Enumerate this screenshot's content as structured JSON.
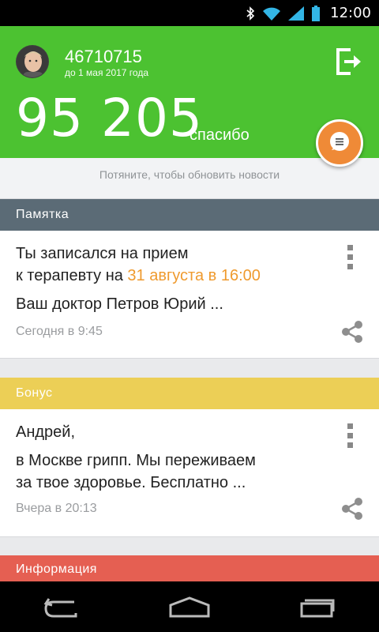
{
  "status_bar": {
    "time": "12:00",
    "icons": [
      "bluetooth-icon",
      "wifi-icon",
      "signal-icon",
      "battery-icon"
    ]
  },
  "header": {
    "account_number": "46710715",
    "valid_until": "до 1 мая 2017 года",
    "balance": "95 205",
    "balance_unit": "спасибо",
    "background_color": "#4cc231",
    "icons": [
      "avatar",
      "logout-icon",
      "chat-icon"
    ]
  },
  "pull_hint": "Потяните, чтобы обновить новости",
  "sections": [
    {
      "title": "Памятка",
      "color": "#5b6b76",
      "card": {
        "line1": "Ты записался на прием",
        "line2_prefix": "к терапевту на ",
        "line2_highlight": "31 августа в 16:00",
        "preview": "Ваш доктор Петров Юрий ...",
        "timestamp": "Сегодня в 9:45"
      }
    },
    {
      "title": "Бонус",
      "color": "#eccf56",
      "card": {
        "line1": "Андрей,",
        "line2": "в Москве грипп. Мы переживаем",
        "line3": "за твое здоровье. Бесплатно ...",
        "timestamp": "Вчера в 20:13"
      }
    },
    {
      "title": "Информация",
      "color": "#e55f52"
    }
  ],
  "nav_bar": {
    "icons": [
      "back-icon",
      "home-icon",
      "recent-apps-icon"
    ]
  }
}
